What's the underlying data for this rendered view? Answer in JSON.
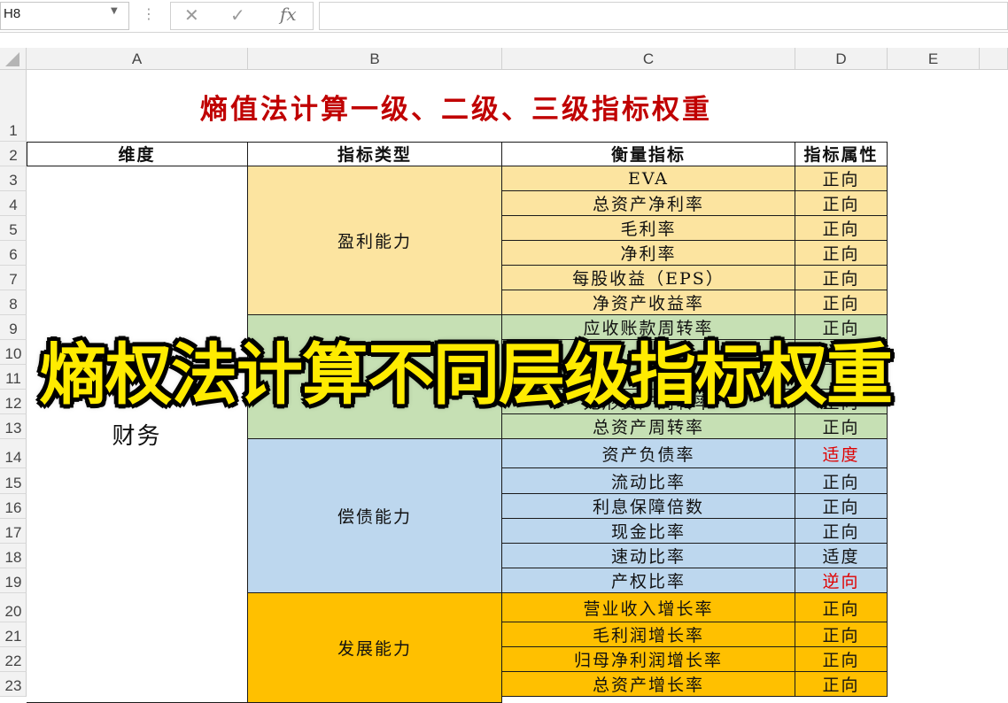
{
  "formula_bar": {
    "name_box": "H8",
    "cancel_icon": "close-icon",
    "enter_icon": "check-icon",
    "fx_label": "fx",
    "formula_value": ""
  },
  "columns": [
    "A",
    "B",
    "C",
    "D",
    "E"
  ],
  "rows": [
    "1",
    "2",
    "3",
    "4",
    "5",
    "6",
    "7",
    "8",
    "9",
    "10",
    "11",
    "12",
    "13",
    "14",
    "15",
    "16",
    "17",
    "18",
    "19",
    "20",
    "21",
    "22",
    "23"
  ],
  "title": "熵值法计算一级、二级、三级指标权重",
  "headers": {
    "dimension": "维度",
    "indicator_type": "指标类型",
    "measure": "衡量指标",
    "attribute": "指标属性"
  },
  "dimension": "财务",
  "groups": [
    {
      "type": "盈利能力",
      "color": "#fce4a0"
    },
    {
      "type": "",
      "color": "#c6e0b4"
    },
    {
      "type": "偿债能力",
      "color": "#bdd7ee"
    },
    {
      "type": "发展能力",
      "color": "#ffc000"
    }
  ],
  "metrics": [
    {
      "name": "EVA",
      "attr": "正向",
      "attr_color": "#111111"
    },
    {
      "name": "总资产净利率",
      "attr": "正向",
      "attr_color": "#111111"
    },
    {
      "name": "毛利率",
      "attr": "正向",
      "attr_color": "#111111"
    },
    {
      "name": "净利率",
      "attr": "正向",
      "attr_color": "#111111"
    },
    {
      "name": "每股收益（EPS）",
      "attr": "正向",
      "attr_color": "#111111"
    },
    {
      "name": "净资产收益率",
      "attr": "正向",
      "attr_color": "#111111"
    },
    {
      "name": "应收账款周转率",
      "attr": "正向",
      "attr_color": "#111111"
    },
    {
      "name": "",
      "attr": "",
      "attr_color": "#111111"
    },
    {
      "name": "",
      "attr": "",
      "attr_color": "#111111"
    },
    {
      "name": "无形资产周转率",
      "attr": "正向",
      "attr_color": "#111111"
    },
    {
      "name": "总资产周转率",
      "attr": "正向",
      "attr_color": "#111111"
    },
    {
      "name": "资产负债率",
      "attr": "适度",
      "attr_color": "#e00000"
    },
    {
      "name": "流动比率",
      "attr": "正向",
      "attr_color": "#111111"
    },
    {
      "name": "利息保障倍数",
      "attr": "正向",
      "attr_color": "#111111"
    },
    {
      "name": "现金比率",
      "attr": "正向",
      "attr_color": "#111111"
    },
    {
      "name": "速动比率",
      "attr": "适度",
      "attr_color": "#111111"
    },
    {
      "name": "产权比率",
      "attr": "逆向",
      "attr_color": "#e00000"
    },
    {
      "name": "营业收入增长率",
      "attr": "正向",
      "attr_color": "#111111"
    },
    {
      "name": "毛利润增长率",
      "attr": "正向",
      "attr_color": "#111111"
    },
    {
      "name": "归母净利润增长率",
      "attr": "正向",
      "attr_color": "#111111"
    },
    {
      "name": "总资产增长率",
      "attr": "正向",
      "attr_color": "#111111"
    }
  ],
  "banner": "熵权法计算不同层级指标权重"
}
